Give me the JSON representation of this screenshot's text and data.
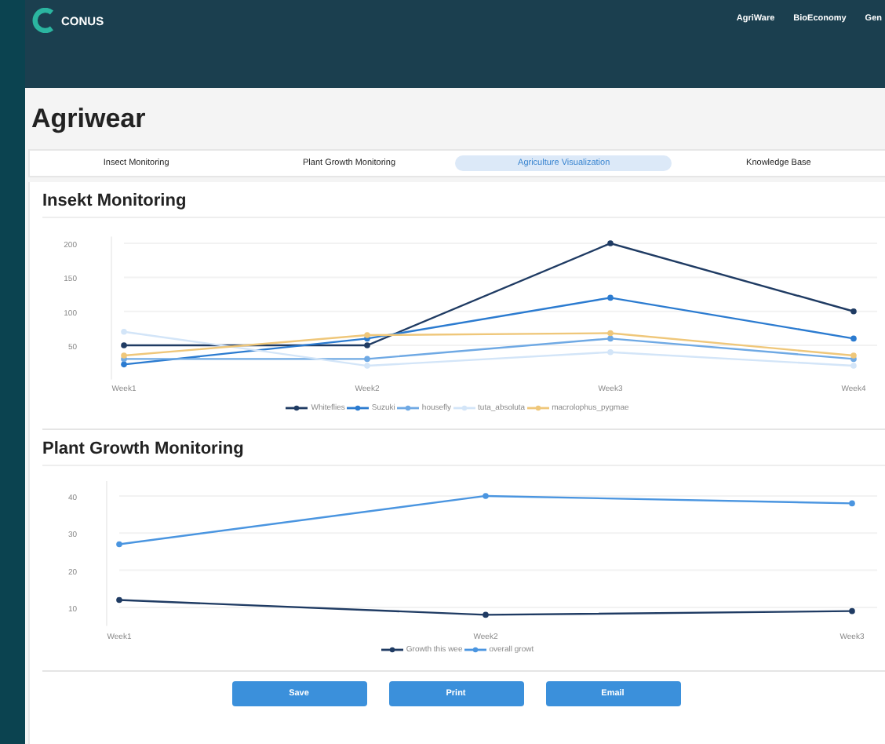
{
  "header": {
    "brand": "CONUS",
    "nav": [
      "AgriWare",
      "BioEconomy",
      "Gen"
    ]
  },
  "page_title": "Agriwear",
  "tabs": [
    {
      "label": "Insect Monitoring",
      "selected": false
    },
    {
      "label": "Plant Growth Monitoring",
      "selected": false
    },
    {
      "label": "Agriculture Visualization",
      "selected": true
    },
    {
      "label": "Knowledge Base",
      "selected": false
    }
  ],
  "sections": [
    {
      "title": "Insekt Monitoring",
      "chart_data": {
        "type": "line",
        "grid": true,
        "legend": "bottom",
        "categories": [
          "Week1",
          "Week2",
          "Week3",
          "Week4"
        ],
        "ylim": [
          0,
          210
        ],
        "yticks": [
          50,
          100,
          150,
          200
        ],
        "series": [
          {
            "name": "Whiteflies",
            "color": "#1f3b63",
            "marker": "circle",
            "values": [
              50,
              50,
              200,
              100
            ]
          },
          {
            "name": "Suzuki",
            "color": "#2b7bd0",
            "marker": "circle",
            "values": [
              22,
              60,
              120,
              60
            ]
          },
          {
            "name": "housefly",
            "color": "#6fa9e4",
            "marker": "circle",
            "values": [
              30,
              30,
              60,
              30
            ]
          },
          {
            "name": "tuta_absoluta",
            "color": "#d3e5f8",
            "marker": "circle",
            "values": [
              70,
              20,
              40,
              20
            ]
          },
          {
            "name": "macrolophus_pygmae",
            "color": "#efc77a",
            "marker": "circle",
            "values": [
              35,
              65,
              68,
              35
            ]
          }
        ]
      }
    },
    {
      "title": "Plant Growth Monitoring",
      "chart_data": {
        "type": "line",
        "grid": true,
        "legend": "bottom",
        "categories": [
          "Week1",
          "Week2",
          "Week3"
        ],
        "ylim": [
          5,
          44
        ],
        "yticks": [
          10,
          20,
          30,
          40
        ],
        "series": [
          {
            "name": "Growth this wee",
            "color": "#1f3b63",
            "marker": "circle",
            "values": [
              12,
              8,
              9
            ]
          },
          {
            "name": "overall growt",
            "color": "#4a95e0",
            "marker": "circle",
            "values": [
              27,
              40,
              38
            ]
          }
        ]
      }
    }
  ],
  "buttons": [
    "Save",
    "Print",
    "Email"
  ]
}
